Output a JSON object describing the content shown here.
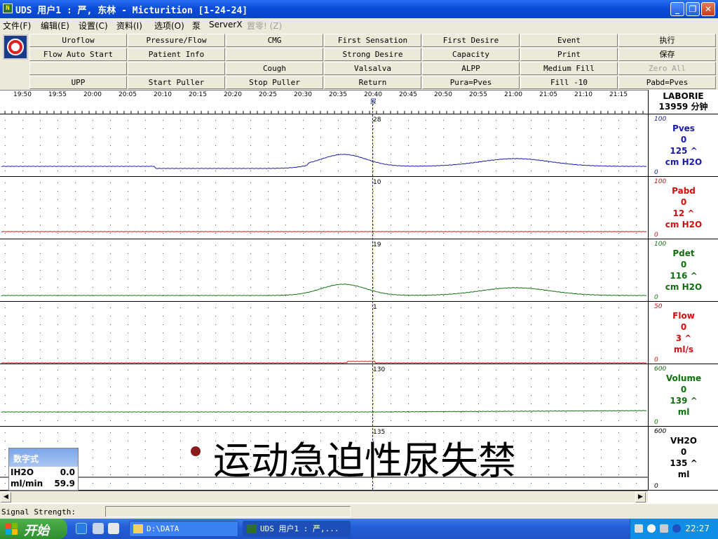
{
  "window": {
    "title": "UDS 用户1 : 严, 东林 - Micturition [1-24-24]",
    "app_icon_text": "N"
  },
  "menu": [
    {
      "label": "文件(F)",
      "enabled": true
    },
    {
      "label": "编辑(E)",
      "enabled": true
    },
    {
      "label": "设置(C)",
      "enabled": true
    },
    {
      "label": "资料(I)",
      "enabled": true
    },
    {
      "label": "选项(O)",
      "enabled": true
    },
    {
      "label": "泵",
      "enabled": true
    },
    {
      "label": "ServerX",
      "enabled": true
    },
    {
      "label": "置零! (Z)",
      "enabled": false
    }
  ],
  "toolbar": {
    "rows": [
      [
        "Uroflow",
        "Pressure/Flow",
        "CMG",
        "First Sensation",
        "First Desire",
        "Event",
        "执行"
      ],
      [
        "Flow Auto Start",
        "Patient Info",
        "",
        "Strong Desire",
        "Capacity",
        "Print",
        "保存"
      ],
      [
        "",
        "",
        "Cough",
        "Valsalva",
        "ALPP",
        "Medium Fill",
        "Zero All"
      ],
      [
        "UPP",
        "Start Puller",
        "Stop Puller",
        "Return",
        "Pura=Pves",
        "Fill -10",
        "Pabd=Pves"
      ]
    ],
    "disabled": [
      "Zero All"
    ]
  },
  "time_axis": {
    "labels": [
      "19:50",
      "19:55",
      "20:00",
      "20:05",
      "20:10",
      "20:15",
      "20:20",
      "20:25",
      "20:30",
      "20:35",
      "20:40",
      "20:45",
      "20:50",
      "20:55",
      "21:00",
      "21:05",
      "21:10",
      "21:15"
    ],
    "cursor_marker": "尿"
  },
  "header_panel": {
    "brand": "LABORIE",
    "duration": "13959 分钟"
  },
  "channels": [
    {
      "name": "Pves",
      "value": "0",
      "cursor": "125 ^",
      "unit": "cm H2O",
      "max": "100",
      "min": "0",
      "cursor_value": "28",
      "color": "#1a1aa8"
    },
    {
      "name": "Pabd",
      "value": "0",
      "cursor": "12 ^",
      "unit": "cm H2O",
      "max": "100",
      "min": "0",
      "cursor_value": "10",
      "color": "#d01010"
    },
    {
      "name": "Pdet",
      "value": "0",
      "cursor": "116 ^",
      "unit": "cm H2O",
      "max": "100",
      "min": "0",
      "cursor_value": "19",
      "color": "#107010"
    },
    {
      "name": "Flow",
      "value": "0",
      "cursor": "3 ^",
      "unit": "ml/s",
      "max": "50",
      "min": "0",
      "cursor_value": "1",
      "color": "#d01010"
    },
    {
      "name": "Volume",
      "value": "0",
      "cursor": "139 ^",
      "unit": "ml",
      "max": "600",
      "min": "0",
      "cursor_value": "130",
      "color": "#107010"
    },
    {
      "name": "VH2O",
      "value": "0",
      "cursor": "135 ^",
      "unit": "ml",
      "max": "600",
      "min": "0",
      "cursor_value": "135",
      "color": "#000000"
    }
  ],
  "overlay": {
    "text": "运动急迫性尿失禁"
  },
  "numeric_panel": {
    "title": "数字式",
    "rows": [
      {
        "label": "IH2O",
        "value": "0.0"
      },
      {
        "label": "ml/min",
        "value": "59.9"
      }
    ]
  },
  "statusbar": {
    "label": "Signal Strength:"
  },
  "taskbar": {
    "start_label": "开始",
    "tasks": [
      {
        "label": "D:\\DATA",
        "active": false
      },
      {
        "label": "UDS 用户1 : 严,...",
        "active": true
      }
    ],
    "clock": "22:27"
  }
}
